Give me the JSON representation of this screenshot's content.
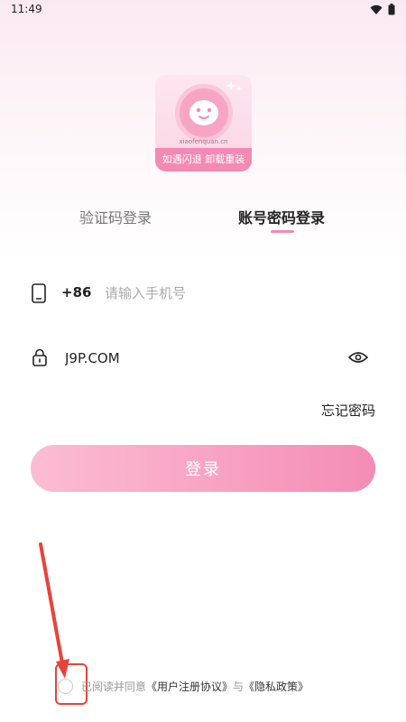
{
  "status_bar": {
    "time": "11:49",
    "icons": [
      "wifi-icon",
      "battery-icon"
    ]
  },
  "logo": {
    "url_text": "xiaofenquan.cn",
    "banner_text": "如遇闪退 卸载重装"
  },
  "tabs": [
    {
      "label": "验证码登录",
      "active": false
    },
    {
      "label": "账号密码登录",
      "active": true
    }
  ],
  "phone": {
    "country_code": "+86",
    "placeholder": "请输入手机号",
    "value": ""
  },
  "password": {
    "value": "J9P.COM"
  },
  "forgot_password": "忘记密码",
  "login_button": "登录",
  "agreement": {
    "prefix": "已阅读并同意",
    "user_agreement": "《用户注册协议》",
    "conjunction": "与",
    "privacy_policy": "《隐私政策》",
    "checked": false
  },
  "colors": {
    "accent": "#f48ab3",
    "annotation": "#e8433a"
  }
}
